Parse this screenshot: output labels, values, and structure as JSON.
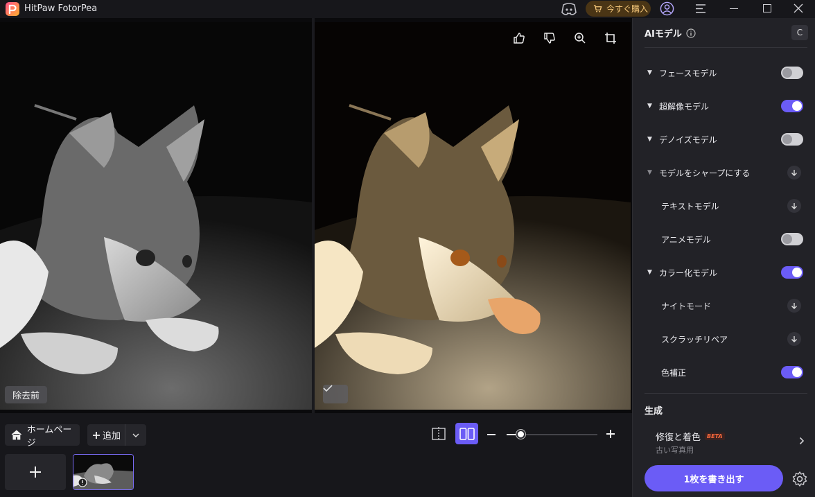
{
  "app": {
    "title": "HitPaw FotorPea",
    "buy_label": "今すぐ購入",
    "icons": [
      "logo-icon",
      "discord-icon",
      "cart-icon",
      "user-icon",
      "menu-icon",
      "minimize-icon",
      "maximize-icon",
      "close-icon"
    ]
  },
  "canvas": {
    "before_label": "除去前",
    "toolbar_icons": [
      "thumbs-up-icon",
      "thumbs-down-icon",
      "zoom-in-icon",
      "crop-icon"
    ]
  },
  "bottom": {
    "home_label": "ホームページ",
    "add_label": "追加",
    "zoom_level": 0.15
  },
  "panel": {
    "header": "AIモデル",
    "reset_label": "C",
    "models": [
      {
        "label": "フェースモデル",
        "level": 0,
        "expanded": true,
        "control": "toggle",
        "on": false
      },
      {
        "label": "超解像モデル",
        "level": 0,
        "expanded": true,
        "control": "toggle",
        "on": true
      },
      {
        "label": "デノイズモデル",
        "level": 0,
        "expanded": true,
        "control": "toggle",
        "on": false
      },
      {
        "label": "モデルをシャープにする",
        "level": 0,
        "expanded": false,
        "control": "download"
      },
      {
        "label": "テキストモデル",
        "level": 1,
        "control": "download"
      },
      {
        "label": "アニメモデル",
        "level": 1,
        "control": "toggle",
        "on": false
      },
      {
        "label": "カラー化モデル",
        "level": 0,
        "expanded": true,
        "control": "toggle",
        "on": true
      },
      {
        "label": "ナイトモード",
        "level": 1,
        "control": "download"
      },
      {
        "label": "スクラッチリペア",
        "level": 1,
        "control": "download"
      },
      {
        "label": "色補正",
        "level": 1,
        "control": "toggle",
        "on": true
      }
    ],
    "generate_title": "生成",
    "generate_item_title": "修復と着色",
    "generate_item_badge": "BETA",
    "generate_item_sub": "古い写真用",
    "export_label": "1枚を書き出す"
  },
  "colors": {
    "accent": "#6b5cf6",
    "buy_text": "#f5c77a",
    "beta": "#ff6a3d"
  }
}
